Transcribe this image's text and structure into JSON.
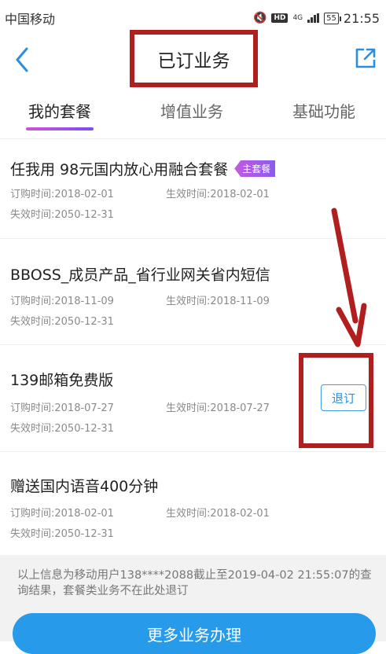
{
  "status_bar": {
    "carrier": "中国移动",
    "hd": "HD",
    "network": "4G",
    "battery": "55",
    "time": "21:55"
  },
  "header": {
    "title": "已订业务"
  },
  "tabs": [
    {
      "label": "我的套餐",
      "active": true
    },
    {
      "label": "增值业务",
      "active": false
    },
    {
      "label": "基础功能",
      "active": false
    }
  ],
  "packages": [
    {
      "name": "任我用 98元国内放心用融合套餐",
      "badge": "主套餐",
      "order_time": "订购时间:2018-02-01",
      "effective_time": "生效时间:2018-02-01",
      "expire_time": "失效时间:2050-12-31"
    },
    {
      "name": "BBOSS_成员产品_省行业网关省内短信",
      "order_time": "订购时间:2018-11-09",
      "effective_time": "生效时间:2018-11-09",
      "expire_time": "失效时间:2050-12-31"
    },
    {
      "name": "139邮箱免费版",
      "order_time": "订购时间:2018-07-27",
      "effective_time": "生效时间:2018-07-27",
      "expire_time": "失效时间:2050-12-31",
      "action": "退订"
    },
    {
      "name": "赠送国内语音400分钟",
      "order_time": "订购时间:2018-02-01",
      "effective_time": "生效时间:2018-02-01",
      "expire_time": "失效时间:2050-12-31"
    }
  ],
  "footer": {
    "note": "以上信息为移动用户138****2088截止至2019-04-02 21:55:07的查询结果，套餐类业务不在此处退订",
    "more_button": "更多业务办理"
  },
  "colors": {
    "accent_blue": "#279ae9",
    "annotation_red": "#b01e1e",
    "badge_purple": "#a95be6"
  }
}
